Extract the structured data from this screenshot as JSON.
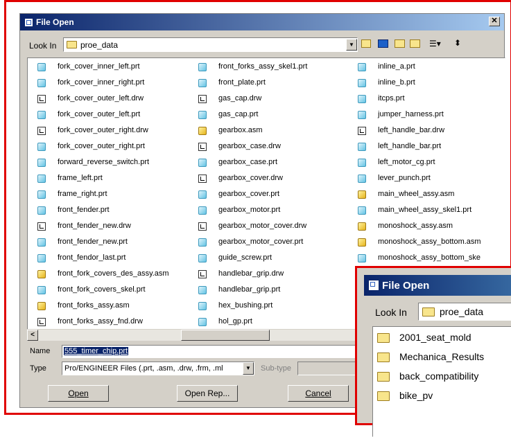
{
  "dialog1": {
    "title": "File Open",
    "close": "✕",
    "look_in_label": "Look In",
    "look_in_value": "proe_data",
    "columns": [
      [
        {
          "name": "fork_cover_inner_left.prt",
          "type": "prt"
        },
        {
          "name": "fork_cover_inner_right.prt",
          "type": "prt"
        },
        {
          "name": "fork_cover_outer_left.drw",
          "type": "drw"
        },
        {
          "name": "fork_cover_outer_left.prt",
          "type": "prt"
        },
        {
          "name": "fork_cover_outer_right.drw",
          "type": "drw"
        },
        {
          "name": "fork_cover_outer_right.prt",
          "type": "prt"
        },
        {
          "name": "forward_reverse_switch.prt",
          "type": "prt"
        },
        {
          "name": "frame_left.prt",
          "type": "prt"
        },
        {
          "name": "frame_right.prt",
          "type": "prt"
        },
        {
          "name": "front_fender.prt",
          "type": "prt"
        },
        {
          "name": "front_fender_new.drw",
          "type": "drw"
        },
        {
          "name": "front_fender_new.prt",
          "type": "prt"
        },
        {
          "name": "front_fendor_last.prt",
          "type": "prt"
        },
        {
          "name": "front_fork_covers_des_assy.asm",
          "type": "asm"
        },
        {
          "name": "front_fork_covers_skel.prt",
          "type": "prt"
        },
        {
          "name": "front_forks_assy.asm",
          "type": "asm"
        },
        {
          "name": "front_forks_assy_fnd.drw",
          "type": "drw"
        }
      ],
      [
        {
          "name": "front_forks_assy_skel1.prt",
          "type": "prt"
        },
        {
          "name": "front_plate.prt",
          "type": "prt"
        },
        {
          "name": "gas_cap.drw",
          "type": "drw"
        },
        {
          "name": "gas_cap.prt",
          "type": "prt"
        },
        {
          "name": "gearbox.asm",
          "type": "asm"
        },
        {
          "name": "gearbox_case.drw",
          "type": "drw"
        },
        {
          "name": "gearbox_case.prt",
          "type": "prt"
        },
        {
          "name": "gearbox_cover.drw",
          "type": "drw"
        },
        {
          "name": "gearbox_cover.prt",
          "type": "prt"
        },
        {
          "name": "gearbox_motor.prt",
          "type": "prt"
        },
        {
          "name": "gearbox_motor_cover.drw",
          "type": "drw"
        },
        {
          "name": "gearbox_motor_cover.prt",
          "type": "prt"
        },
        {
          "name": "guide_screw.prt",
          "type": "prt"
        },
        {
          "name": "handlebar_grip.drw",
          "type": "drw"
        },
        {
          "name": "handlebar_grip.prt",
          "type": "prt"
        },
        {
          "name": "hex_bushing.prt",
          "type": "prt"
        },
        {
          "name": "hol_gp.prt",
          "type": "prt"
        }
      ],
      [
        {
          "name": "inline_a.prt",
          "type": "prt"
        },
        {
          "name": "inline_b.prt",
          "type": "prt"
        },
        {
          "name": "itcps.prt",
          "type": "prt"
        },
        {
          "name": "jumper_harness.prt",
          "type": "prt"
        },
        {
          "name": "left_handle_bar.drw",
          "type": "drw"
        },
        {
          "name": "left_handle_bar.prt",
          "type": "prt"
        },
        {
          "name": "left_motor_cg.prt",
          "type": "prt"
        },
        {
          "name": "lever_punch.prt",
          "type": "prt"
        },
        {
          "name": "main_wheel_assy.asm",
          "type": "asm"
        },
        {
          "name": "main_wheel_assy_skel1.prt",
          "type": "prt"
        },
        {
          "name": "monoshock_assy.asm",
          "type": "asm"
        },
        {
          "name": "monoshock_assy_bottom.asm",
          "type": "asm"
        },
        {
          "name": "monoshock_assy_bottom_ske",
          "type": "prt"
        }
      ]
    ],
    "name_label": "Name",
    "name_value": "555_timer_chip.prt",
    "type_label": "Type",
    "type_value": "Pro/ENGINEER Files (.prt, .asm, .drw, .frm, .ml",
    "subtype_label": "Sub-type",
    "open_button": "Open",
    "open_rep_button": "Open Rep...",
    "cancel_button": "Cancel",
    "scroll_left": "<"
  },
  "dialog2": {
    "title": "File Open",
    "look_in_label": "Look In",
    "look_in_value": "proe_data",
    "folders": [
      "2001_seat_mold",
      "Mechanica_Results",
      "back_compatibility",
      "bike_pv"
    ]
  }
}
